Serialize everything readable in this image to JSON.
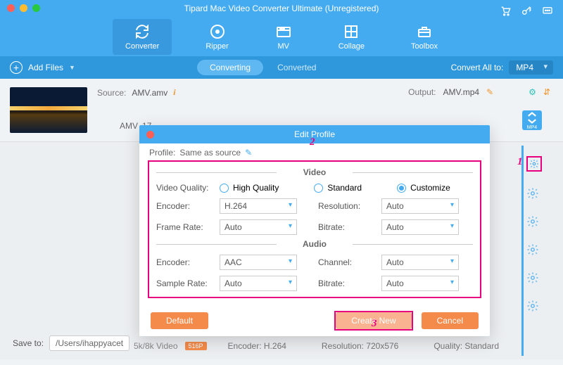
{
  "app": {
    "title": "Tipard Mac Video Converter Ultimate (Unregistered)"
  },
  "tabs": [
    "Converter",
    "Ripper",
    "MV",
    "Collage",
    "Toolbox"
  ],
  "subbar": {
    "addfiles": "Add Files",
    "seg1": "Converting",
    "seg2": "Converted",
    "convertall": "Convert All to:",
    "format": "MP4"
  },
  "file": {
    "source_label": "Source:",
    "source": "AMV.amv",
    "output_label": "Output:",
    "output": "AMV.mp4",
    "amv": "AMV",
    "amv2": "17",
    "badge": "MP4"
  },
  "save": {
    "label": "Save to:",
    "path": "/Users/ihappyacet"
  },
  "botinfo": {
    "a": "5k/8k Video",
    "b": "516P",
    "enc": "Encoder: H.264",
    "res": "Resolution: 720x576",
    "qual": "Quality: Standard"
  },
  "modal": {
    "title": "Edit Profile",
    "profile_label": "Profile:",
    "profile_value": "Same as source",
    "sec_video": "Video",
    "sec_audio": "Audio",
    "vq_label": "Video Quality:",
    "vq_hq": "High Quality",
    "vq_std": "Standard",
    "vq_cust": "Customize",
    "v_enc_label": "Encoder:",
    "v_enc": "H.264",
    "v_res_label": "Resolution:",
    "v_res": "Auto",
    "v_fr_label": "Frame Rate:",
    "v_fr": "Auto",
    "v_br_label": "Bitrate:",
    "v_br": "Auto",
    "a_enc_label": "Encoder:",
    "a_enc": "AAC",
    "a_ch_label": "Channel:",
    "a_ch": "Auto",
    "a_sr_label": "Sample Rate:",
    "a_sr": "Auto",
    "a_br_label": "Bitrate:",
    "a_br": "Auto",
    "btn_default": "Default",
    "btn_create": "Create New",
    "btn_cancel": "Cancel"
  },
  "ann": {
    "one": "1",
    "two": "2",
    "three": "3"
  }
}
